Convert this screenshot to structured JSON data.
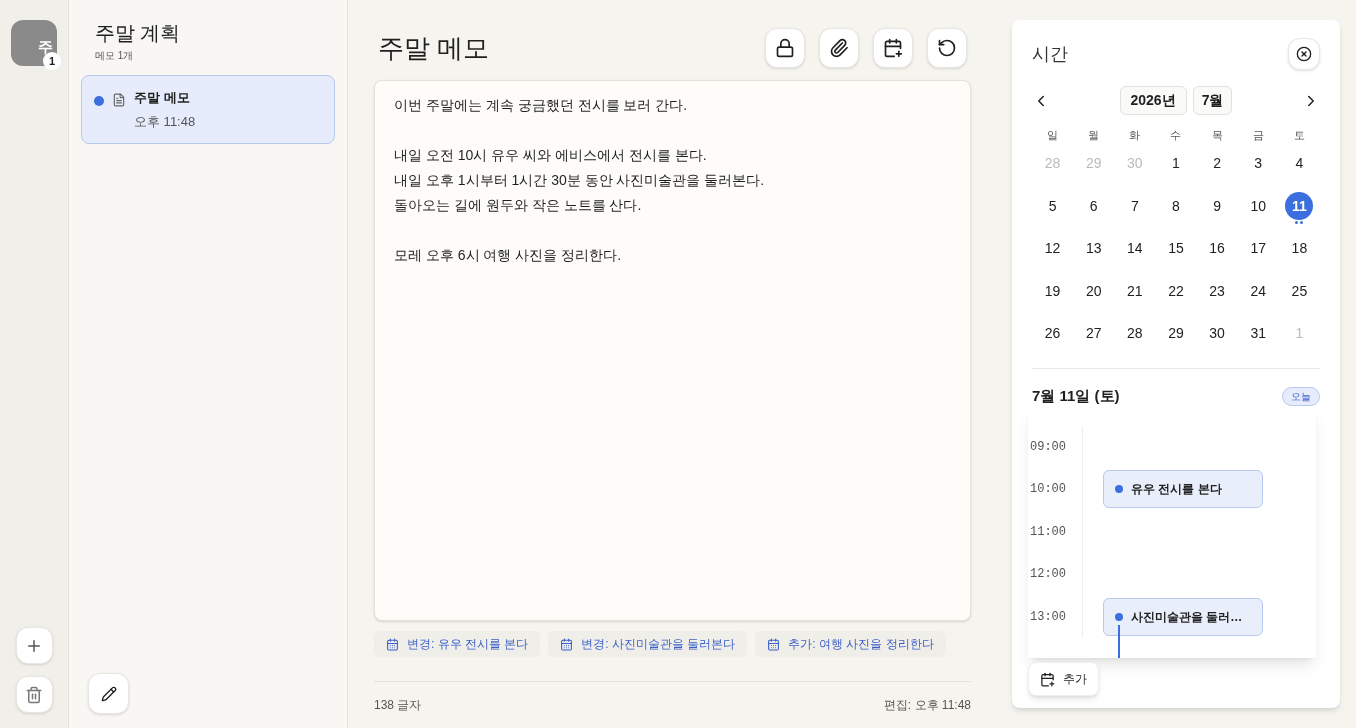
{
  "rail": {
    "avatar": "주",
    "badge": "1"
  },
  "list": {
    "title": "주말 계획",
    "subtitle": "메모 1개",
    "notes": [
      {
        "title": "주말 메모",
        "time": "오후 11:48",
        "selected": true,
        "color": "#3b6fe0"
      }
    ]
  },
  "editor": {
    "title": "주말 메모",
    "paragraphs": [
      [
        "이번 주말에는 계속 궁금했던 전시를 보러 간다."
      ],
      [
        "내일 오전 10시 유우 씨와 에비스에서 전시를 본다.",
        "내일 오후 1시부터 1시간 30분 동안 사진미술관을 둘러본다.",
        "돌아오는 길에 원두와 작은 노트를 산다."
      ],
      [
        "모레 오후 6시 여행 사진을 정리한다."
      ]
    ],
    "chips": [
      "변경: 유우 전시를 본다",
      "변경: 사진미술관을 둘러본다",
      "추가: 여행 사진을 정리한다"
    ],
    "char_count": "138 글자",
    "edited": "편집: 오후 11:48"
  },
  "calendar": {
    "title": "시간",
    "year": "2026년",
    "month": "7월",
    "weekdays": [
      "일",
      "월",
      "화",
      "수",
      "목",
      "금",
      "토"
    ],
    "weeks": [
      [
        {
          "label": "28",
          "outside": true,
          "selected": false,
          "has_events": false
        },
        {
          "label": "29",
          "outside": true,
          "selected": false,
          "has_events": false
        },
        {
          "label": "30",
          "outside": true,
          "selected": false,
          "has_events": false
        },
        {
          "label": "1",
          "outside": false,
          "selected": false,
          "has_events": false
        },
        {
          "label": "2",
          "outside": false,
          "selected": false,
          "has_events": false
        },
        {
          "label": "3",
          "outside": false,
          "selected": false,
          "has_events": false
        },
        {
          "label": "4",
          "outside": false,
          "selected": false,
          "has_events": false
        }
      ],
      [
        {
          "label": "5",
          "outside": false,
          "selected": false,
          "has_events": false
        },
        {
          "label": "6",
          "outside": false,
          "selected": false,
          "has_events": false
        },
        {
          "label": "7",
          "outside": false,
          "selected": false,
          "has_events": false
        },
        {
          "label": "8",
          "outside": false,
          "selected": false,
          "has_events": false
        },
        {
          "label": "9",
          "outside": false,
          "selected": false,
          "has_events": false
        },
        {
          "label": "10",
          "outside": false,
          "selected": false,
          "has_events": false
        },
        {
          "label": "11",
          "outside": false,
          "selected": true,
          "has_events": true
        }
      ],
      [
        {
          "label": "12",
          "outside": false,
          "selected": false,
          "has_events": false
        },
        {
          "label": "13",
          "outside": false,
          "selected": false,
          "has_events": false
        },
        {
          "label": "14",
          "outside": false,
          "selected": false,
          "has_events": false
        },
        {
          "label": "15",
          "outside": false,
          "selected": false,
          "has_events": false
        },
        {
          "label": "16",
          "outside": false,
          "selected": false,
          "has_events": false
        },
        {
          "label": "17",
          "outside": false,
          "selected": false,
          "has_events": false
        },
        {
          "label": "18",
          "outside": false,
          "selected": false,
          "has_events": false
        }
      ],
      [
        {
          "label": "19",
          "outside": false,
          "selected": false,
          "has_events": false
        },
        {
          "label": "20",
          "outside": false,
          "selected": false,
          "has_events": false
        },
        {
          "label": "21",
          "outside": false,
          "selected": false,
          "has_events": false
        },
        {
          "label": "22",
          "outside": false,
          "selected": false,
          "has_events": false
        },
        {
          "label": "23",
          "outside": false,
          "selected": false,
          "has_events": false
        },
        {
          "label": "24",
          "outside": false,
          "selected": false,
          "has_events": false
        },
        {
          "label": "25",
          "outside": false,
          "selected": false,
          "has_events": false
        }
      ],
      [
        {
          "label": "26",
          "outside": false,
          "selected": false,
          "has_events": false
        },
        {
          "label": "27",
          "outside": false,
          "selected": false,
          "has_events": false
        },
        {
          "label": "28",
          "outside": false,
          "selected": false,
          "has_events": false
        },
        {
          "label": "29",
          "outside": false,
          "selected": false,
          "has_events": false
        },
        {
          "label": "30",
          "outside": false,
          "selected": false,
          "has_events": false
        },
        {
          "label": "31",
          "outside": false,
          "selected": false,
          "has_events": false
        },
        {
          "label": "1",
          "outside": true,
          "selected": false,
          "has_events": false
        }
      ]
    ],
    "day_title": "7월 11일 (토)",
    "today": "오늘",
    "hours": [
      {
        "label": "09:00"
      },
      {
        "label": "10:00",
        "events": [
          {
            "title": "유우 전시를 본다",
            "continues": false
          }
        ]
      },
      {
        "label": "11:00"
      },
      {
        "label": "12:00"
      },
      {
        "label": "13:00",
        "events": [
          {
            "title": "사진미술관을 둘러…",
            "continues": true
          }
        ]
      }
    ],
    "add": "추가"
  }
}
